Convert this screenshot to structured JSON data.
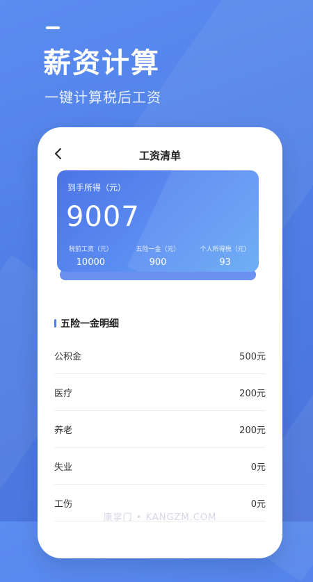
{
  "promo": {
    "title": "薪资计算",
    "subtitle": "一键计算税后工资"
  },
  "phone": {
    "title": "工资清单",
    "back_icon": "chevron-left-icon",
    "summary": {
      "label": "到手所得（元）",
      "value": "9007",
      "stats": [
        {
          "label": "税前工资（元）",
          "value": "10000"
        },
        {
          "label": "五险一金（元）",
          "value": "900"
        },
        {
          "label": "个人所得税（元）",
          "value": "93"
        }
      ]
    },
    "section_title": "五险一金明细",
    "rows": [
      {
        "label": "公积金",
        "value": "500元"
      },
      {
        "label": "医疗",
        "value": "200元"
      },
      {
        "label": "养老",
        "value": "200元"
      },
      {
        "label": "失业",
        "value": "0元"
      },
      {
        "label": "工伤",
        "value": "0元"
      }
    ]
  },
  "watermark": "康掌门 • KANGZM.COM",
  "colors": {
    "background": "#4f7fe6",
    "card_start": "#4d73e6",
    "card_end": "#63a8f6",
    "accent": "#4f7fe6"
  }
}
